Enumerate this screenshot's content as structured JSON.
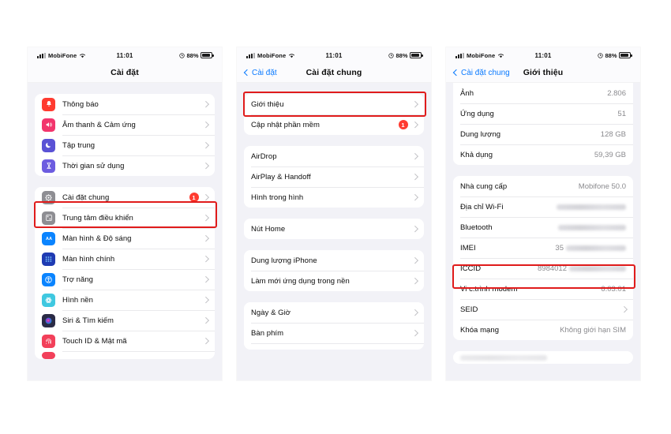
{
  "statusbar": {
    "carrier": "MobiFone",
    "time": "11:01",
    "battery_pct": "88%"
  },
  "phone1": {
    "nav": {
      "title": "Cài đặt",
      "back": null
    },
    "groups": [
      {
        "rows": [
          {
            "label": "Thông báo",
            "icon": "bell-icon",
            "color": "#ff3b30",
            "chevron": true
          },
          {
            "label": "Âm thanh & Cảm ứng",
            "icon": "speaker-icon",
            "color": "#f2356c",
            "chevron": true
          },
          {
            "label": "Tập trung",
            "icon": "moon-icon",
            "color": "#5a52d5",
            "chevron": true
          },
          {
            "label": "Thời gian sử dụng",
            "icon": "hourglass-icon",
            "color": "#6c5ce0",
            "chevron": true
          }
        ]
      },
      {
        "rows": [
          {
            "label": "Cài đặt chung",
            "icon": "gear-icon",
            "color": "#8e8e93",
            "badge": "1",
            "chevron": true
          },
          {
            "label": "Trung tâm điều khiển",
            "icon": "control-center-icon",
            "color": "#8e8e93",
            "chevron": true
          },
          {
            "label": "Màn hình & Độ sáng",
            "icon": "aa-icon",
            "color": "#0a84ff",
            "chevron": true
          },
          {
            "label": "Màn hình chính",
            "icon": "home-screen-icon",
            "color": "#1f3bb3",
            "chevron": true
          },
          {
            "label": "Trợ năng",
            "icon": "accessibility-icon",
            "color": "#0a84ff",
            "chevron": true
          },
          {
            "label": "Hình nền",
            "icon": "wallpaper-icon",
            "color": "#3fc8e0",
            "chevron": true
          },
          {
            "label": "Siri & Tìm kiếm",
            "icon": "siri-icon",
            "color": "#2b2b46",
            "chevron": true
          },
          {
            "label": "Touch ID & Mật mã",
            "icon": "touch-id-icon",
            "color": "#f2405a",
            "chevron": true
          }
        ]
      }
    ],
    "highlight_label": "Cài đặt chung"
  },
  "phone2": {
    "nav": {
      "back": "Cài đặt",
      "title": "Cài đặt chung"
    },
    "groups": [
      {
        "rows": [
          {
            "label": "Giới thiệu",
            "chevron": true
          },
          {
            "label": "Cập nhật phần mềm",
            "badge": "1",
            "chevron": true
          }
        ]
      },
      {
        "rows": [
          {
            "label": "AirDrop",
            "chevron": true
          },
          {
            "label": "AirPlay & Handoff",
            "chevron": true
          },
          {
            "label": "Hình trong hình",
            "chevron": true
          }
        ]
      },
      {
        "rows": [
          {
            "label": "Nút Home",
            "chevron": true
          }
        ]
      },
      {
        "rows": [
          {
            "label": "Dung lượng iPhone",
            "chevron": true
          },
          {
            "label": "Làm mới ứng dụng trong nền",
            "chevron": true
          }
        ]
      },
      {
        "rows": [
          {
            "label": "Ngày & Giờ",
            "chevron": true
          },
          {
            "label": "Bàn phím",
            "chevron": true
          }
        ]
      }
    ],
    "highlight_label": "Giới thiệu"
  },
  "phone3": {
    "nav": {
      "back": "Cài đặt chung",
      "title": "Giới thiệu"
    },
    "groups": [
      {
        "rows": [
          {
            "label": "Ảnh",
            "value": "2.806"
          },
          {
            "label": "Ứng dụng",
            "value": "51"
          },
          {
            "label": "Dung lượng",
            "value": "128 GB"
          },
          {
            "label": "Khả dụng",
            "value": "59,39 GB"
          }
        ]
      },
      {
        "rows": [
          {
            "label": "Nhà cung cấp",
            "value": "Mobifone 50.0"
          },
          {
            "label": "Địa chỉ Wi-Fi",
            "value": "",
            "redacted": true
          },
          {
            "label": "Bluetooth",
            "value": "",
            "redacted": true
          },
          {
            "label": "IMEI",
            "value": "35",
            "redacted": true
          },
          {
            "label": "ICCID",
            "value": "8984012",
            "redacted": true
          },
          {
            "label": "Vi c.trình modem",
            "value": "6.03.01"
          },
          {
            "label": "SEID",
            "value": "",
            "chevron": true
          },
          {
            "label": "Khóa mạng",
            "value": "Không giới hạn SIM"
          }
        ]
      }
    ],
    "highlight_label": "ICCID"
  },
  "colors": {
    "highlight_red": "#e01b1b",
    "accent_blue": "#0a7aff",
    "badge_red": "#ff3b30",
    "page_bg": "#f2f2f7"
  }
}
